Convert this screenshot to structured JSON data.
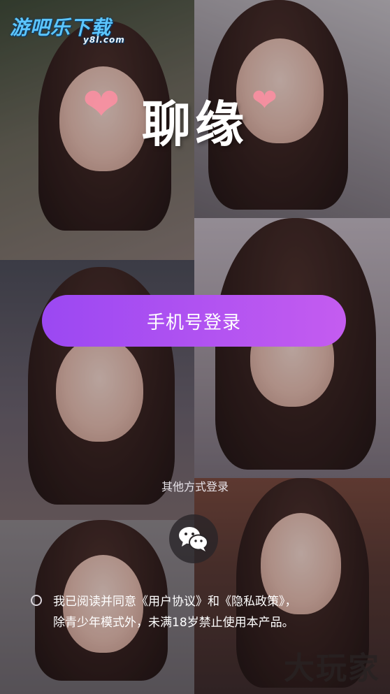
{
  "watermark": {
    "text": "游吧乐下载",
    "sub": "y8l.com"
  },
  "app": {
    "title": "聊缘"
  },
  "login": {
    "phone_button_label": "手机号登录"
  },
  "other_login": {
    "label": "其他方式登录",
    "wechat_icon": "wechat-icon"
  },
  "agreement": {
    "prefix": "我已阅读并同意",
    "user_agreement_link": "《用户协议》",
    "conjunction": "和",
    "privacy_policy_link": "《隐私政策》",
    "suffix": "，",
    "line2": "除青少年模式外，未满18岁禁止使用本产品。"
  },
  "corner_watermark": "大玩家",
  "colors": {
    "button_gradient_start": "#9b48f2",
    "button_gradient_end": "#c45cf0",
    "heart": "#ff8fa3",
    "watermark": "#5cc6ff"
  }
}
